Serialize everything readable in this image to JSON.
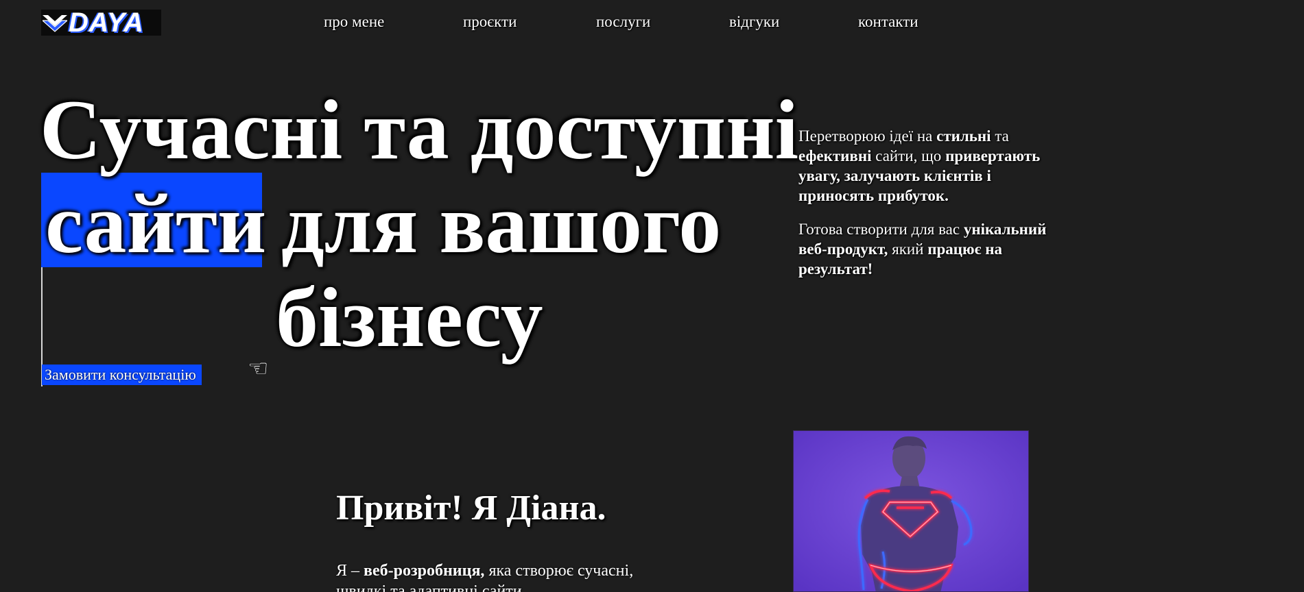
{
  "header": {
    "logo_text": "DAYA",
    "nav": [
      {
        "label": "про мене"
      },
      {
        "label": "проєкти"
      },
      {
        "label": "послуги"
      },
      {
        "label": "відгуки"
      },
      {
        "label": "контакти"
      }
    ]
  },
  "hero": {
    "line1": "Сучасні та доступні",
    "line2_highlight": "сайти",
    "line2_rest": "для вашого",
    "line3": "бізнесу",
    "cta_label": "Замовити консультацію",
    "intro": {
      "p1_a": "Перетворюю ідеї на ",
      "p1_b": "стильні",
      "p1_c": " та ",
      "p1_d": "ефективні",
      "p1_e": " сайти, що ",
      "p1_f": "привертають увагу, залучають клієнтів і приносять прибуток.",
      "p2_a": "Готова створити для вас ",
      "p2_b": "унікальний веб-продукт,",
      "p2_c": " який ",
      "p2_d": "працює на результат!"
    }
  },
  "about": {
    "title": "Привіт! Я Діана.",
    "text_a": "Я – ",
    "text_b": "веб-розробниця,",
    "text_c": " яка створює сучасні, швидкі та адаптивні сайти"
  },
  "colors": {
    "background": "#1e1e1e",
    "accent_blue": "#0a47ff",
    "neon_red": "#ff2a4d",
    "neon_blue": "#2f5bff",
    "photo_bg": "#6a3fd1"
  },
  "icons": {
    "logo_mark": "chevron-down-icon",
    "cursor": "pointer-hand-icon"
  }
}
